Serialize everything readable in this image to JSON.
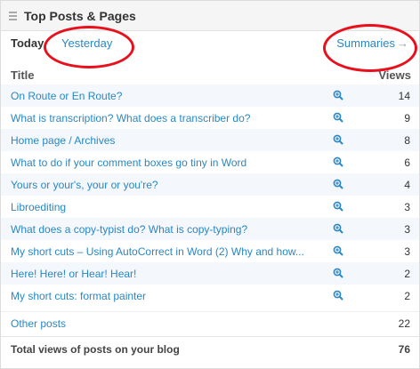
{
  "widget": {
    "title": "Top Posts & Pages",
    "tabs": {
      "today": "Today",
      "yesterday": "Yesterday"
    },
    "summaries_label": "Summaries",
    "columns": {
      "title": "Title",
      "views": "Views"
    },
    "rows": [
      {
        "title": "On Route or En Route?",
        "views": "14"
      },
      {
        "title": "What is transcription? What does a transcriber do?",
        "views": "9"
      },
      {
        "title": "Home page / Archives",
        "views": "8"
      },
      {
        "title": "What to do if your comment boxes go tiny in Word",
        "views": "6"
      },
      {
        "title": "Yours or your's, your or you're?",
        "views": "4"
      },
      {
        "title": "Libroediting",
        "views": "3"
      },
      {
        "title": "What does a copy-typist do? What is copy-typing?",
        "views": "3"
      },
      {
        "title": "My short cuts – Using AutoCorrect in Word (2) Why and how...",
        "views": "3"
      },
      {
        "title": "Here! Here! or Hear! Hear!",
        "views": "2"
      },
      {
        "title": "My short cuts: format painter",
        "views": "2"
      }
    ],
    "other_posts": {
      "label": "Other posts",
      "views": "22"
    },
    "total": {
      "label": "Total views of posts on your blog",
      "views": "76"
    },
    "icons": {
      "drag": "drag-handle-icon",
      "zoom": "magnifier-plus-icon",
      "arrow": "arrow-right-icon"
    },
    "colors": {
      "link": "#2a87c4",
      "annotation": "#e8101c"
    }
  }
}
